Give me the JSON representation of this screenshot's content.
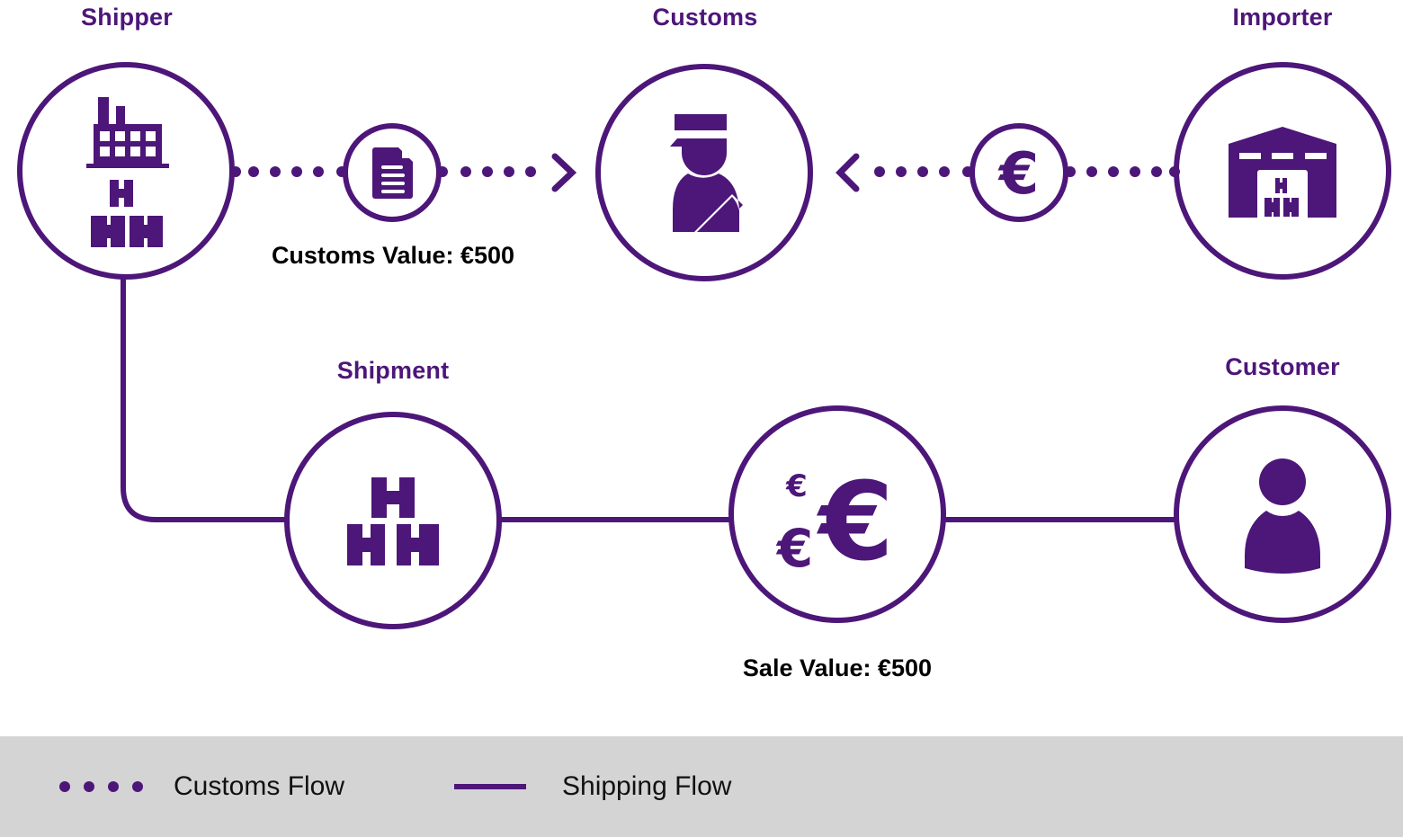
{
  "colors": {
    "accent": "#4d1679",
    "text": "#000000",
    "legend_bg": "#d4d4d4"
  },
  "nodes": {
    "shipper": {
      "label": "Shipper",
      "icon": "factory-with-boxes-icon"
    },
    "customs": {
      "label": "Customs",
      "icon": "customs-officer-icon"
    },
    "importer": {
      "label": "Importer",
      "icon": "warehouse-icon"
    },
    "shipment": {
      "label": "Shipment",
      "icon": "boxes-icon"
    },
    "sale": {
      "label": "",
      "icon": "euro-coins-icon"
    },
    "customer": {
      "label": "Customer",
      "icon": "person-icon"
    }
  },
  "connectors": {
    "document": {
      "icon": "document-icon"
    },
    "payment": {
      "icon": "euro-icon"
    }
  },
  "values": {
    "customs_value": "Customs Value: €500",
    "sale_value": "Sale Value: €500"
  },
  "legend": {
    "customs_flow": "Customs Flow",
    "shipping_flow": "Shipping Flow"
  }
}
